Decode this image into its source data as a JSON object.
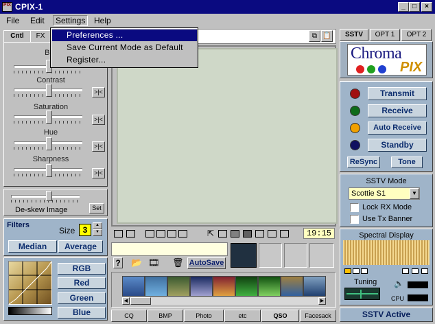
{
  "window": {
    "title": "CPIX-1",
    "icon_text": "PIX",
    "minimize": "_",
    "maximize": "□",
    "close": "×"
  },
  "menu": {
    "file": "File",
    "edit": "Edit",
    "settings": "Settings",
    "help": "Help"
  },
  "settings_menu": {
    "items": [
      "Preferences ...",
      "Save Current Mode as Default",
      "Register..."
    ]
  },
  "left_tabs": {
    "cntl": "Cntl",
    "fx": "FX"
  },
  "sliders": {
    "brightness": "Brigh",
    "contrast": "Contrast",
    "saturation": "Saturation",
    "hue": "Hue",
    "sharpness": "Sharpness",
    "deskew": "De-skew Image"
  },
  "reset_label": ">|<",
  "set_label": "Set",
  "filters": {
    "title": "Filters",
    "size_label": "Size",
    "size_value": "3",
    "median": "Median",
    "average": "Average"
  },
  "color_buttons": {
    "rgb": "RGB",
    "red": "Red",
    "green": "Green",
    "blue": "Blue"
  },
  "time": "19:15",
  "autosave": "AutoSave",
  "bottom_tabs": [
    "CQ",
    "BMP",
    "Photo",
    "etc",
    "QSO",
    "Facesack"
  ],
  "right_tabs": {
    "sstv": "SSTV",
    "opt1": "OPT 1",
    "opt2": "OPT 2"
  },
  "logo": {
    "top": "Chroma",
    "bottom": "PIX"
  },
  "controls": {
    "transmit": "Transmit",
    "receive": "Receive",
    "auto_receive": "Auto Receive",
    "standby": "Standby",
    "resync": "ReSync",
    "tone": "Tone"
  },
  "led_colors": {
    "transmit": "#a01010",
    "receive": "#0d6b1a",
    "auto_receive": "#f0a000",
    "standby": "#101060"
  },
  "sstv_mode": {
    "title": "SSTV Mode",
    "value": "Scottie S1",
    "lock_rx": "Lock RX Mode",
    "use_tx_banner": "Use Tx Banner"
  },
  "spectral": {
    "title": "Spectral Display",
    "tuning": "Tuning",
    "cpu": "CPU"
  },
  "status": "SSTV Active",
  "icons": [
    "pix-app-icon",
    "chevron-down-icon",
    "folder-open-icon",
    "camera-icon",
    "trash-icon",
    "speaker-icon",
    "help-icon",
    "copy-icon",
    "paste-icon"
  ]
}
